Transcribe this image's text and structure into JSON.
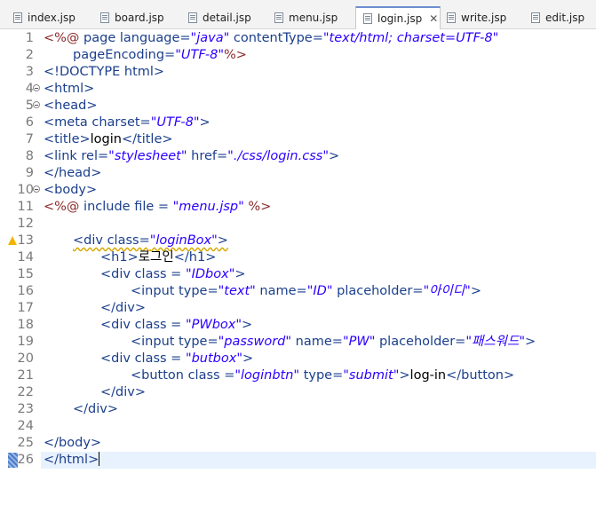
{
  "tabs": [
    {
      "label": "index.jsp",
      "active": false
    },
    {
      "label": "board.jsp",
      "active": false
    },
    {
      "label": "detail.jsp",
      "active": false
    },
    {
      "label": "menu.jsp",
      "active": false
    },
    {
      "label": "login.jsp",
      "active": true,
      "close": "✕"
    },
    {
      "label": "write.jsp",
      "active": false
    },
    {
      "label": "edit.jsp",
      "active": false
    }
  ],
  "gutter": {
    "line_numbers": [
      "1",
      "2",
      "3",
      "4",
      "5",
      "6",
      "7",
      "8",
      "9",
      "10",
      "11",
      "12",
      "13",
      "14",
      "15",
      "16",
      "17",
      "18",
      "19",
      "20",
      "21",
      "22",
      "23",
      "24",
      "25",
      "26"
    ]
  },
  "code": {
    "l1": [
      "<%@",
      " page language=",
      "\"java\"",
      " contentType=",
      "\"text/html; charset=UTF-8\""
    ],
    "l2": [
      "pageEncoding=",
      "\"UTF-8\"",
      "%>"
    ],
    "l3": "<!DOCTYPE html>",
    "l4": "<html>",
    "l5": "<head>",
    "l6": [
      "<meta charset=",
      "\"UTF-8\"",
      ">"
    ],
    "l7": [
      "<title>",
      "login",
      "</title>"
    ],
    "l8": [
      "<link rel=",
      "\"stylesheet\"",
      " href=",
      "\"./css/login.css\"",
      ">"
    ],
    "l9": "</head>",
    "l10": "<body>",
    "l11": [
      "<%@",
      " include file = ",
      "\"menu.jsp\"",
      " %>"
    ],
    "l13": [
      "<div class=",
      "\"loginBox\"",
      ">"
    ],
    "l14": [
      "<h1>",
      "로그인",
      "</h1>"
    ],
    "l15": [
      "<div class = ",
      "\"IDbox\"",
      ">"
    ],
    "l16": [
      "<input type=",
      "\"text\"",
      " name=",
      "\"ID\"",
      " placeholder=",
      "\"아이디\"",
      ">"
    ],
    "l17": "</div>",
    "l18": [
      "<div class = ",
      "\"PWbox\"",
      ">"
    ],
    "l19": [
      "<input type=",
      "\"password\"",
      " name=",
      "\"PW\"",
      " placeholder=",
      "\"패스워드\"",
      ">"
    ],
    "l20": [
      "<div class = ",
      "\"butbox\"",
      ">"
    ],
    "l21": [
      "<button class =",
      "\"loginbtn\"",
      " type=",
      "\"submit\"",
      ">",
      "log-in",
      "</button>"
    ],
    "l22": "</div>",
    "l23": "</div>",
    "l25": "</body>",
    "l26": "</html>"
  }
}
